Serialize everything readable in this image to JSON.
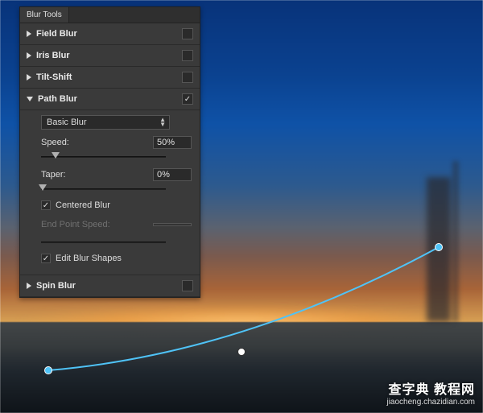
{
  "panel": {
    "tab": "Blur Tools",
    "sections": {
      "field_blur": {
        "label": "Field Blur",
        "enabled": false
      },
      "iris_blur": {
        "label": "Iris Blur",
        "enabled": false
      },
      "tilt_shift": {
        "label": "Tilt-Shift",
        "enabled": false
      },
      "path_blur": {
        "label": "Path Blur",
        "enabled": true,
        "type_dropdown": "Basic Blur",
        "speed": {
          "label": "Speed:",
          "value": "50%",
          "pos": 13
        },
        "taper": {
          "label": "Taper:",
          "value": "0%",
          "pos": 0
        },
        "centered_blur": {
          "label": "Centered Blur",
          "checked": true
        },
        "end_point_speed": {
          "label": "End Point Speed:",
          "value": "",
          "pos": 0,
          "disabled": true
        },
        "edit_blur_shapes": {
          "label": "Edit Blur Shapes",
          "checked": true
        }
      },
      "spin_blur": {
        "label": "Spin Blur",
        "enabled": false
      }
    }
  },
  "watermark": {
    "line1": "查字典 教程网",
    "line2": "jiaocheng.chazidian.com"
  }
}
